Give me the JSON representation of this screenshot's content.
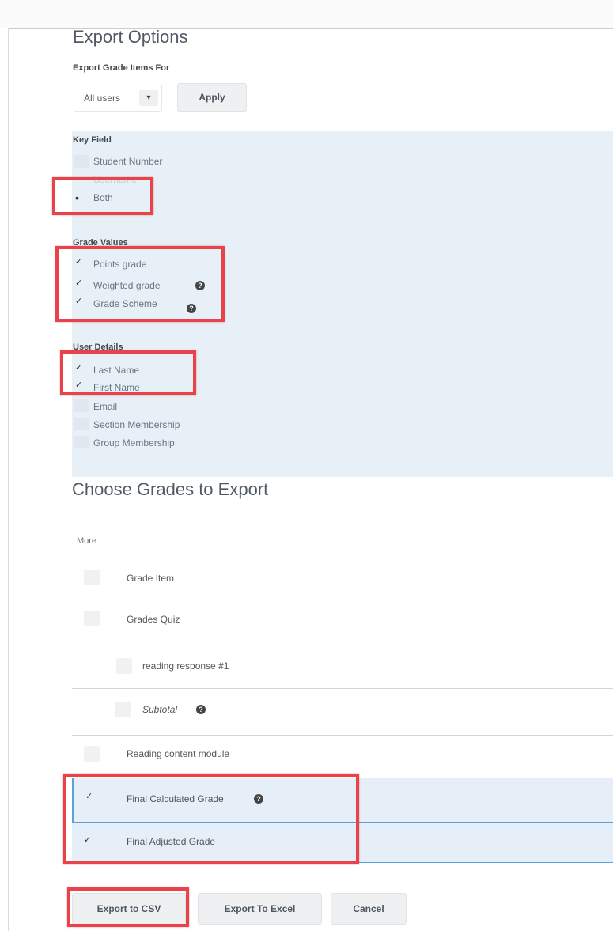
{
  "export_options": {
    "title": "Export Options",
    "export_for_label": "Export Grade Items For",
    "users_select": "All users",
    "apply_label": "Apply"
  },
  "key_field": {
    "label": "Key Field",
    "options": [
      "Student Number",
      "Username",
      "Both"
    ],
    "selected": "Both"
  },
  "grade_values": {
    "label": "Grade Values",
    "items": [
      {
        "label": "Points grade",
        "checked": true,
        "help": false
      },
      {
        "label": "Weighted grade",
        "checked": true,
        "help": true
      },
      {
        "label": "Grade Scheme",
        "checked": true,
        "help": true
      }
    ]
  },
  "user_details": {
    "label": "User Details",
    "items": [
      {
        "label": "Last Name",
        "checked": true
      },
      {
        "label": "First Name",
        "checked": true
      },
      {
        "label": "Email",
        "checked": false
      },
      {
        "label": "Section Membership",
        "checked": false
      },
      {
        "label": "Group Membership",
        "checked": false
      }
    ]
  },
  "grades_section": {
    "title": "Choose Grades to Export",
    "more_label": "More",
    "rows": [
      {
        "label": "Grade Item",
        "checked": false
      },
      {
        "label": "Grades Quiz",
        "checked": false
      },
      {
        "label": "reading response #1",
        "checked": false
      },
      {
        "label": "Subtotal",
        "checked": false,
        "help": true
      },
      {
        "label": "Reading content module",
        "checked": false
      },
      {
        "label": "Final Calculated Grade",
        "checked": true,
        "help": true
      },
      {
        "label": "Final Adjusted Grade",
        "checked": true
      }
    ]
  },
  "actions": {
    "export_csv": "Export to CSV",
    "export_excel": "Export To Excel",
    "cancel": "Cancel"
  },
  "symbols": {
    "check": "✓",
    "radio_dot": "•",
    "caret": "▾",
    "help": "?"
  },
  "colors": {
    "highlight_red": "#e8424a",
    "panel_blue": "#e8f0f7",
    "selected_row": "#e6eff8"
  }
}
